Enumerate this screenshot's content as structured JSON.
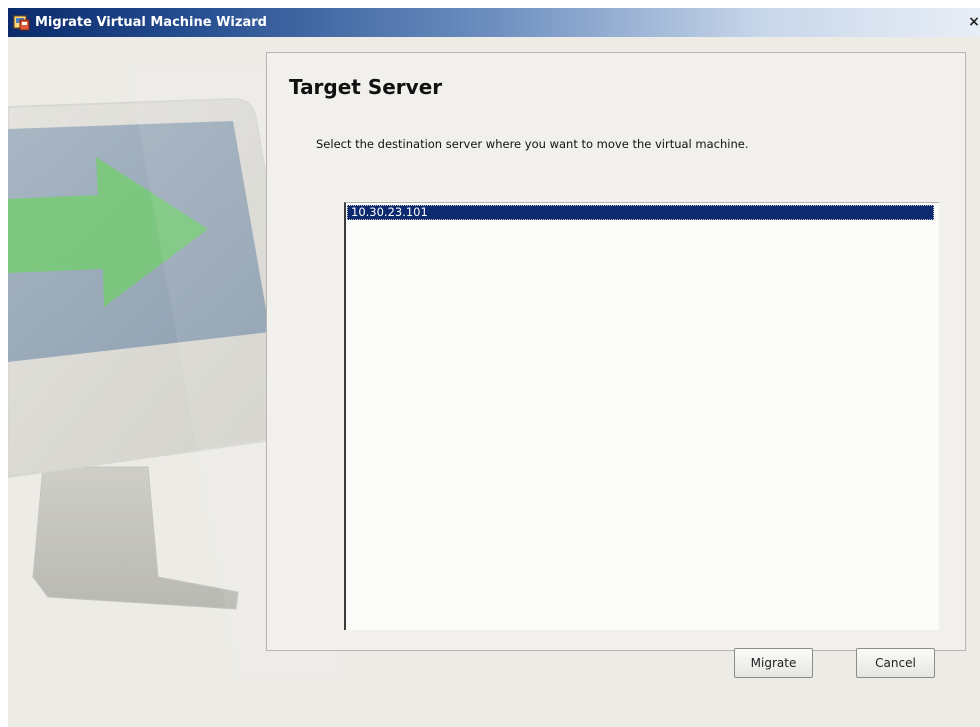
{
  "window": {
    "title": "Migrate Virtual Machine Wizard",
    "close_glyph": "×"
  },
  "page": {
    "heading": "Target Server",
    "description": "Select the destination server where you want to move the virtual machine."
  },
  "server_list": {
    "items": [
      "10.30.23.101"
    ],
    "selected_index": 0
  },
  "buttons": {
    "migrate": "Migrate",
    "cancel": "Cancel"
  },
  "icons": {
    "title": "wizard-app-icon",
    "graphic": "monitor-arrow-illustration"
  },
  "colors": {
    "titlebar_dark": "#0a2a6b",
    "selection": "#0d2a6e",
    "window_bg": "#ecebe6",
    "arrow_green": "#79c97a"
  }
}
